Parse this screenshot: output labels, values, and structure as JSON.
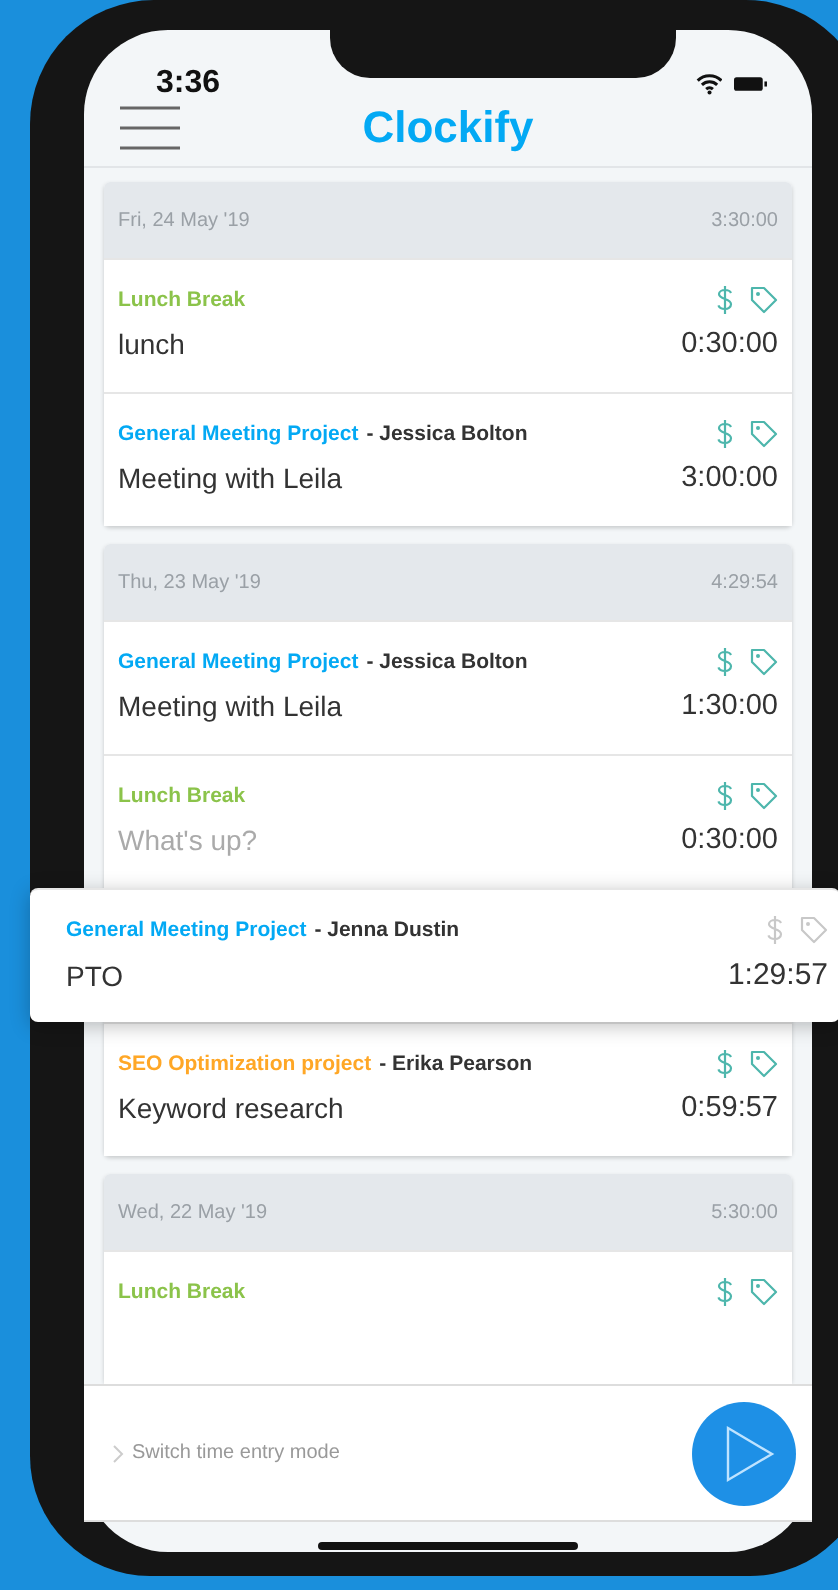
{
  "status_bar": {
    "time": "3:36"
  },
  "header": {
    "logo": "Clockify"
  },
  "days": [
    {
      "date": "Fri, 24 May '19",
      "total": "3:30:00",
      "entries": [
        {
          "kind": "entry",
          "project": "Lunch Break",
          "color": "#8bc34a",
          "description": "lunch",
          "duration": "0:30:00",
          "icons_active": true
        },
        {
          "kind": "entry",
          "project": "General Meeting Project",
          "color": "#03a9f4",
          "client": "- Jessica Bolton",
          "description": "Meeting with Leila",
          "duration": "3:00:00",
          "icons_active": true
        }
      ]
    },
    {
      "date": "Thu, 23 May '19",
      "total": "4:29:54",
      "entries": [
        {
          "kind": "entry",
          "project": "General Meeting Project",
          "color": "#03a9f4",
          "client": "- Jessica Bolton",
          "description": "Meeting with Leila",
          "duration": "1:30:00",
          "icons_active": true
        },
        {
          "kind": "entry",
          "project": "Lunch Break",
          "color": "#8bc34a",
          "placeholder": "What's up?",
          "duration": "0:30:00",
          "icons_active": true
        },
        {
          "kind": "lifted",
          "project": "General Meeting Project",
          "color": "#03a9f4",
          "client": "- Jenna Dustin",
          "description": "PTO",
          "duration": "1:29:57",
          "icons_active": false
        },
        {
          "kind": "entry",
          "project": "SEO Optimization project",
          "color": "#ffa726",
          "client": "- Erika Pearson",
          "description": "Keyword research",
          "duration": "0:59:57",
          "icons_active": true
        }
      ]
    },
    {
      "date": "Wed, 22 May '19",
      "total": "5:30:00",
      "entries": [
        {
          "kind": "entry",
          "project": "Lunch Break",
          "color": "#8bc34a",
          "icons_active": true
        }
      ]
    }
  ],
  "footer": {
    "mode_link": "Switch time entry mode"
  }
}
